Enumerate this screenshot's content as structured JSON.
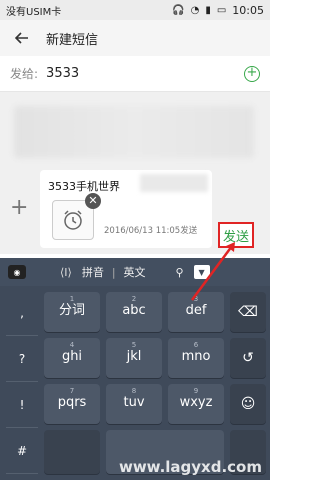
{
  "status": {
    "carrier": "没有USIM卡",
    "time": "10:05"
  },
  "header": {
    "title": "新建短信"
  },
  "recipient": {
    "label": "发给:",
    "value": "3533"
  },
  "compose": {
    "text": "3533手机世界",
    "meta": "2016/06/13 11:05发送",
    "send_label": "发送"
  },
  "keyboard": {
    "bar": {
      "cursor": "⟨I⟩",
      "mode": "拼音",
      "lang": "英文"
    },
    "symbols": [
      ",",
      "?",
      "!",
      "#"
    ],
    "rows": [
      [
        "分词",
        "abc",
        "def"
      ],
      [
        "ghi",
        "jkl",
        "mno"
      ],
      [
        "pqrs",
        "tuv",
        "wxyz"
      ]
    ],
    "subs": [
      "1",
      "2",
      "3",
      "4",
      "5",
      "6",
      "7",
      "8",
      "9"
    ]
  },
  "watermark": "www.lagyxd.com"
}
